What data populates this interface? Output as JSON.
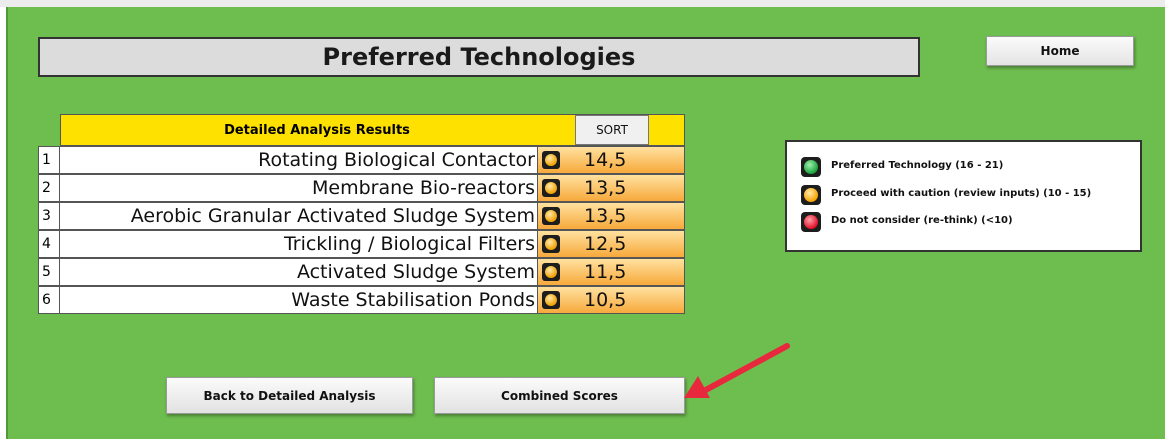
{
  "title": "Preferred Technologies",
  "home_label": "Home",
  "table": {
    "header": "Detailed Analysis Results",
    "sort_label": "SORT",
    "rows": [
      {
        "num": "1",
        "name": "Rotating Biological Contactor",
        "score": "14,5",
        "status": "caution"
      },
      {
        "num": "2",
        "name": "Membrane Bio-reactors",
        "score": "13,5",
        "status": "caution"
      },
      {
        "num": "3",
        "name": "Aerobic Granular Activated Sludge System",
        "score": "13,5",
        "status": "caution"
      },
      {
        "num": "4",
        "name": "Trickling / Biological Filters",
        "score": "12,5",
        "status": "caution"
      },
      {
        "num": "5",
        "name": "Activated Sludge System",
        "score": "11,5",
        "status": "caution"
      },
      {
        "num": "6",
        "name": "Waste Stabilisation Ponds",
        "score": "10,5",
        "status": "caution"
      }
    ]
  },
  "legend": {
    "items": [
      {
        "label": "Preferred Technology (16 - 21)",
        "color": "#1aa33a"
      },
      {
        "label": "Proceed with caution (review inputs) (10 - 15)",
        "color": "#f4a300"
      },
      {
        "label": "Do not consider (re-think) (<10)",
        "color": "#e0102a"
      }
    ]
  },
  "buttons": {
    "back": "Back to Detailed Analysis",
    "combined": "Combined Scores"
  },
  "colors": {
    "background": "#6ebe4f",
    "header_yellow": "#ffe100",
    "annotation_arrow": "#e8283c"
  }
}
